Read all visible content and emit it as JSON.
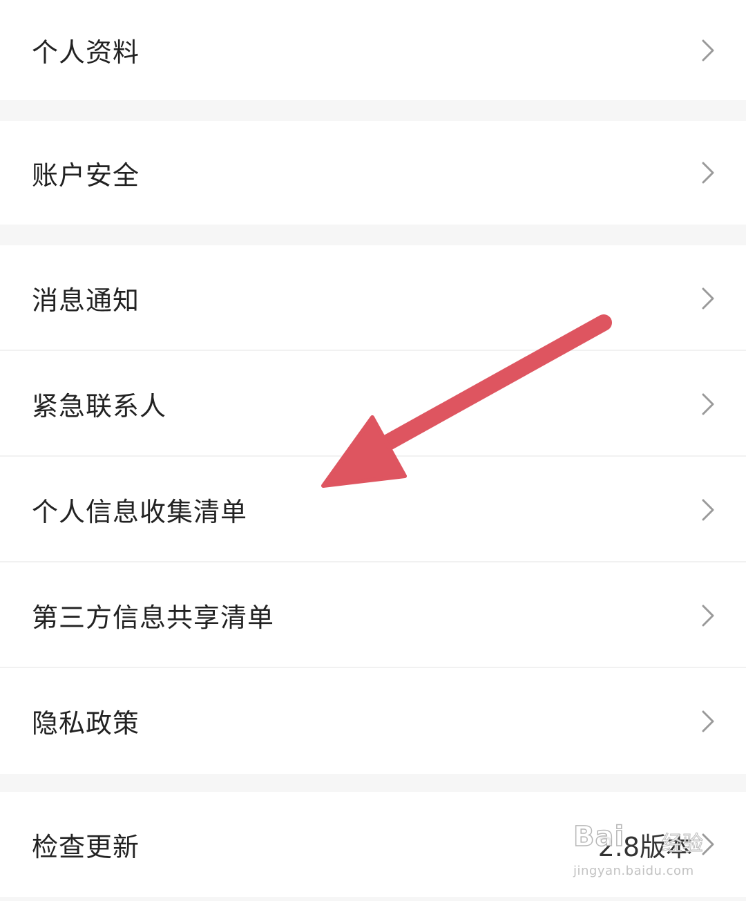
{
  "settings": {
    "group1": [
      {
        "label": "个人资料"
      }
    ],
    "group2": [
      {
        "label": "账户安全"
      }
    ],
    "group3": [
      {
        "label": "消息通知"
      },
      {
        "label": "紧急联系人"
      },
      {
        "label": "个人信息收集清单"
      },
      {
        "label": "第三方信息共享清单"
      },
      {
        "label": "隐私政策"
      }
    ],
    "group4": [
      {
        "label": "检查更新",
        "value": "2.8版本"
      }
    ]
  },
  "watermark": {
    "brand": "Bai",
    "brand_suffix": "经验",
    "url": "jingyan.baidu.com"
  },
  "annotation": {
    "arrow_color": "#de5560",
    "chevron_icon": "chevron-right-icon"
  }
}
